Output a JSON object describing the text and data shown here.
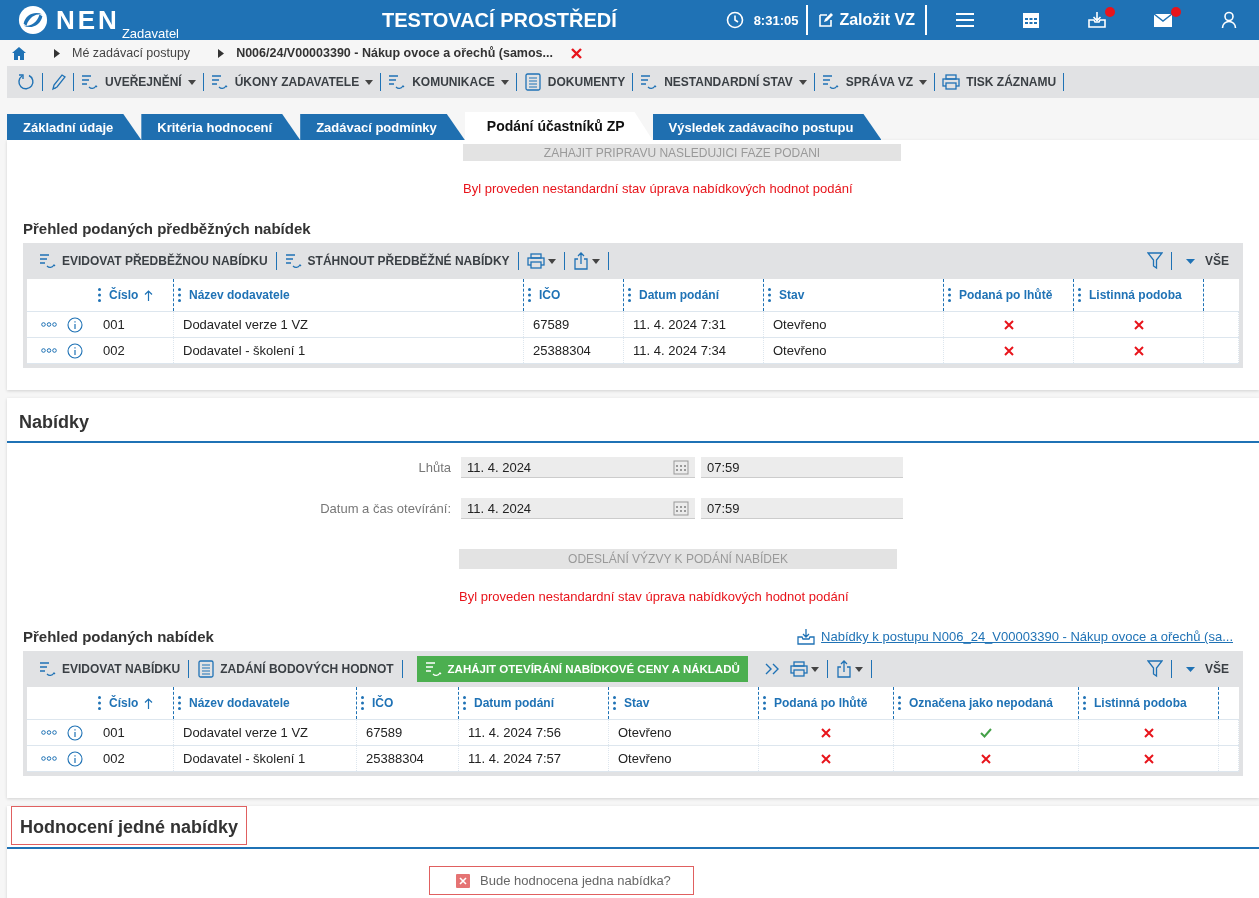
{
  "header": {
    "logo": "NEN",
    "role": "Zadavatel",
    "title": "TESTOVACÍ PROSTŘEDÍ",
    "time": "8:31:05",
    "create": "Založit VZ",
    "icons": [
      {
        "badge": false
      },
      {
        "badge": false
      },
      {
        "badge": true
      },
      {
        "badge": true
      },
      {
        "badge": false
      }
    ]
  },
  "breadcrumb": [
    "Mé zadávací postupy",
    "N006/24/V00003390 - Nákup ovoce a ořechů (samos..."
  ],
  "toolbar": [
    {
      "kind": "refresh"
    },
    {
      "kind": "edit"
    },
    {
      "kind": "menu",
      "label": "UVEŘEJNĚNÍ",
      "dropdown": true
    },
    {
      "kind": "menu",
      "label": "ÚKONY ZADAVATELE",
      "dropdown": true
    },
    {
      "kind": "menu",
      "label": "KOMUNIKACE",
      "dropdown": true
    },
    {
      "kind": "documents",
      "label": "DOKUMENTY",
      "dropdown": false
    },
    {
      "kind": "menu",
      "label": "NESTANDARDNÍ STAV",
      "dropdown": true
    },
    {
      "kind": "menu",
      "label": "SPRÁVA VZ",
      "dropdown": true
    },
    {
      "kind": "print",
      "label": "TISK ZÁZNAMU",
      "dropdown": false
    }
  ],
  "tabs": [
    {
      "label": "Základní údaje",
      "selected": false
    },
    {
      "label": "Kritéria hodnocení",
      "selected": false
    },
    {
      "label": "Zadávací podmínky",
      "selected": false
    },
    {
      "label": "Podání účastníků ZP",
      "selected": true
    },
    {
      "label": "Výsledek zadávacího postupu",
      "selected": false
    }
  ],
  "preliminary": {
    "action": {
      "label": "ZAHAJIT PRIPRAVU NASLEDUJICI FAZE PODANI",
      "disabled": true
    },
    "warning": "Byl proveden nestandardní stav úprava nabídkových hodnot podání",
    "title": "Přehled podaných předběžných nabídek",
    "grid": {
      "tools": [
        {
          "kind": "action",
          "label": "EVIDOVAT PŘEDBĚŽNOU NABÍDKU"
        },
        {
          "kind": "action",
          "label": "STÁHNOUT PŘEDBĚŽNÉ NABÍDKY"
        },
        {
          "kind": "print"
        },
        {
          "kind": "export"
        }
      ],
      "filter": "VŠE",
      "columns": [
        {
          "label": "Číslo",
          "kind": "text",
          "sorted": true
        },
        {
          "label": "Název dodavatele",
          "kind": "text",
          "sorted": false
        },
        {
          "label": "IČO",
          "kind": "text",
          "sorted": false
        },
        {
          "label": "Datum podání",
          "kind": "text",
          "sorted": false
        },
        {
          "label": "Stav",
          "kind": "text",
          "sorted": false
        },
        {
          "label": "Podaná po lhůtě",
          "kind": "flag",
          "sorted": false
        },
        {
          "label": "Listinná podoba",
          "kind": "flag",
          "sorted": false
        }
      ],
      "rows": [
        {
          "cells": [
            "001",
            "Dodavatel verze 1 VZ",
            "67589",
            "11. 4. 2024 7:31",
            "Otevřeno",
            false,
            false
          ]
        },
        {
          "cells": [
            "002",
            "Dodavatel - školení 1",
            "25388304",
            "11. 4. 2024 7:34",
            "Otevřeno",
            false,
            false
          ]
        }
      ]
    }
  },
  "offers": {
    "heading": "Nabídky",
    "fields": [
      {
        "label": "Lhůta",
        "date": "11. 4. 2024",
        "time": "07:59"
      },
      {
        "label": "Datum a čas otevírání:",
        "date": "11. 4. 2024",
        "time": "07:59"
      }
    ],
    "action": {
      "label": "ODESLÁNÍ VÝZVY K PODÁNÍ NABÍDEK",
      "disabled": true
    },
    "warning": "Byl proveden nestandardní stav úprava nabídkových hodnot podání",
    "title": "Přehled podaných nabídek",
    "link": "Nabídky k postupu N006_24_V00003390 - Nákup ovoce a ořechů (sa...",
    "grid": {
      "tools": [
        {
          "kind": "action",
          "label": "EVIDOVAT NABÍDKU"
        },
        {
          "kind": "document",
          "label": "ZADÁNÍ BODOVÝCH HODNOT"
        },
        {
          "kind": "primary",
          "label": "ZAHÁJIT OTEVÍRÁNÍ NABÍDKOVÉ CENY A NÁKLADŮ"
        },
        {
          "kind": "more"
        },
        {
          "kind": "print"
        },
        {
          "kind": "export"
        }
      ],
      "filter": "VŠE",
      "columns": [
        {
          "label": "Číslo",
          "kind": "text",
          "sorted": true
        },
        {
          "label": "Název dodavatele",
          "kind": "text",
          "sorted": false
        },
        {
          "label": "IČO",
          "kind": "text",
          "sorted": false
        },
        {
          "label": "Datum podání",
          "kind": "text",
          "sorted": false
        },
        {
          "label": "Stav",
          "kind": "text",
          "sorted": false
        },
        {
          "label": "Podaná po lhůtě",
          "kind": "flag",
          "sorted": false
        },
        {
          "label": "Označena jako nepodaná",
          "kind": "flag",
          "sorted": false
        },
        {
          "label": "Listinná podoba",
          "kind": "flag",
          "sorted": false
        }
      ],
      "rows": [
        {
          "cells": [
            "001",
            "Dodavatel verze 1 VZ",
            "67589",
            "11. 4. 2024 7:56",
            "Otevřeno",
            false,
            true,
            false
          ]
        },
        {
          "cells": [
            "002",
            "Dodavatel - školení 1",
            "25388304",
            "11. 4. 2024 7:57",
            "Otevřeno",
            false,
            false,
            false
          ]
        }
      ]
    }
  },
  "evaluation": {
    "heading": "Hodnocení jedné nabídky",
    "highlighted": true,
    "checkbox": {
      "label": "Bude hodnocena jedna nabídka?",
      "checked": false,
      "highlighted": true
    }
  }
}
